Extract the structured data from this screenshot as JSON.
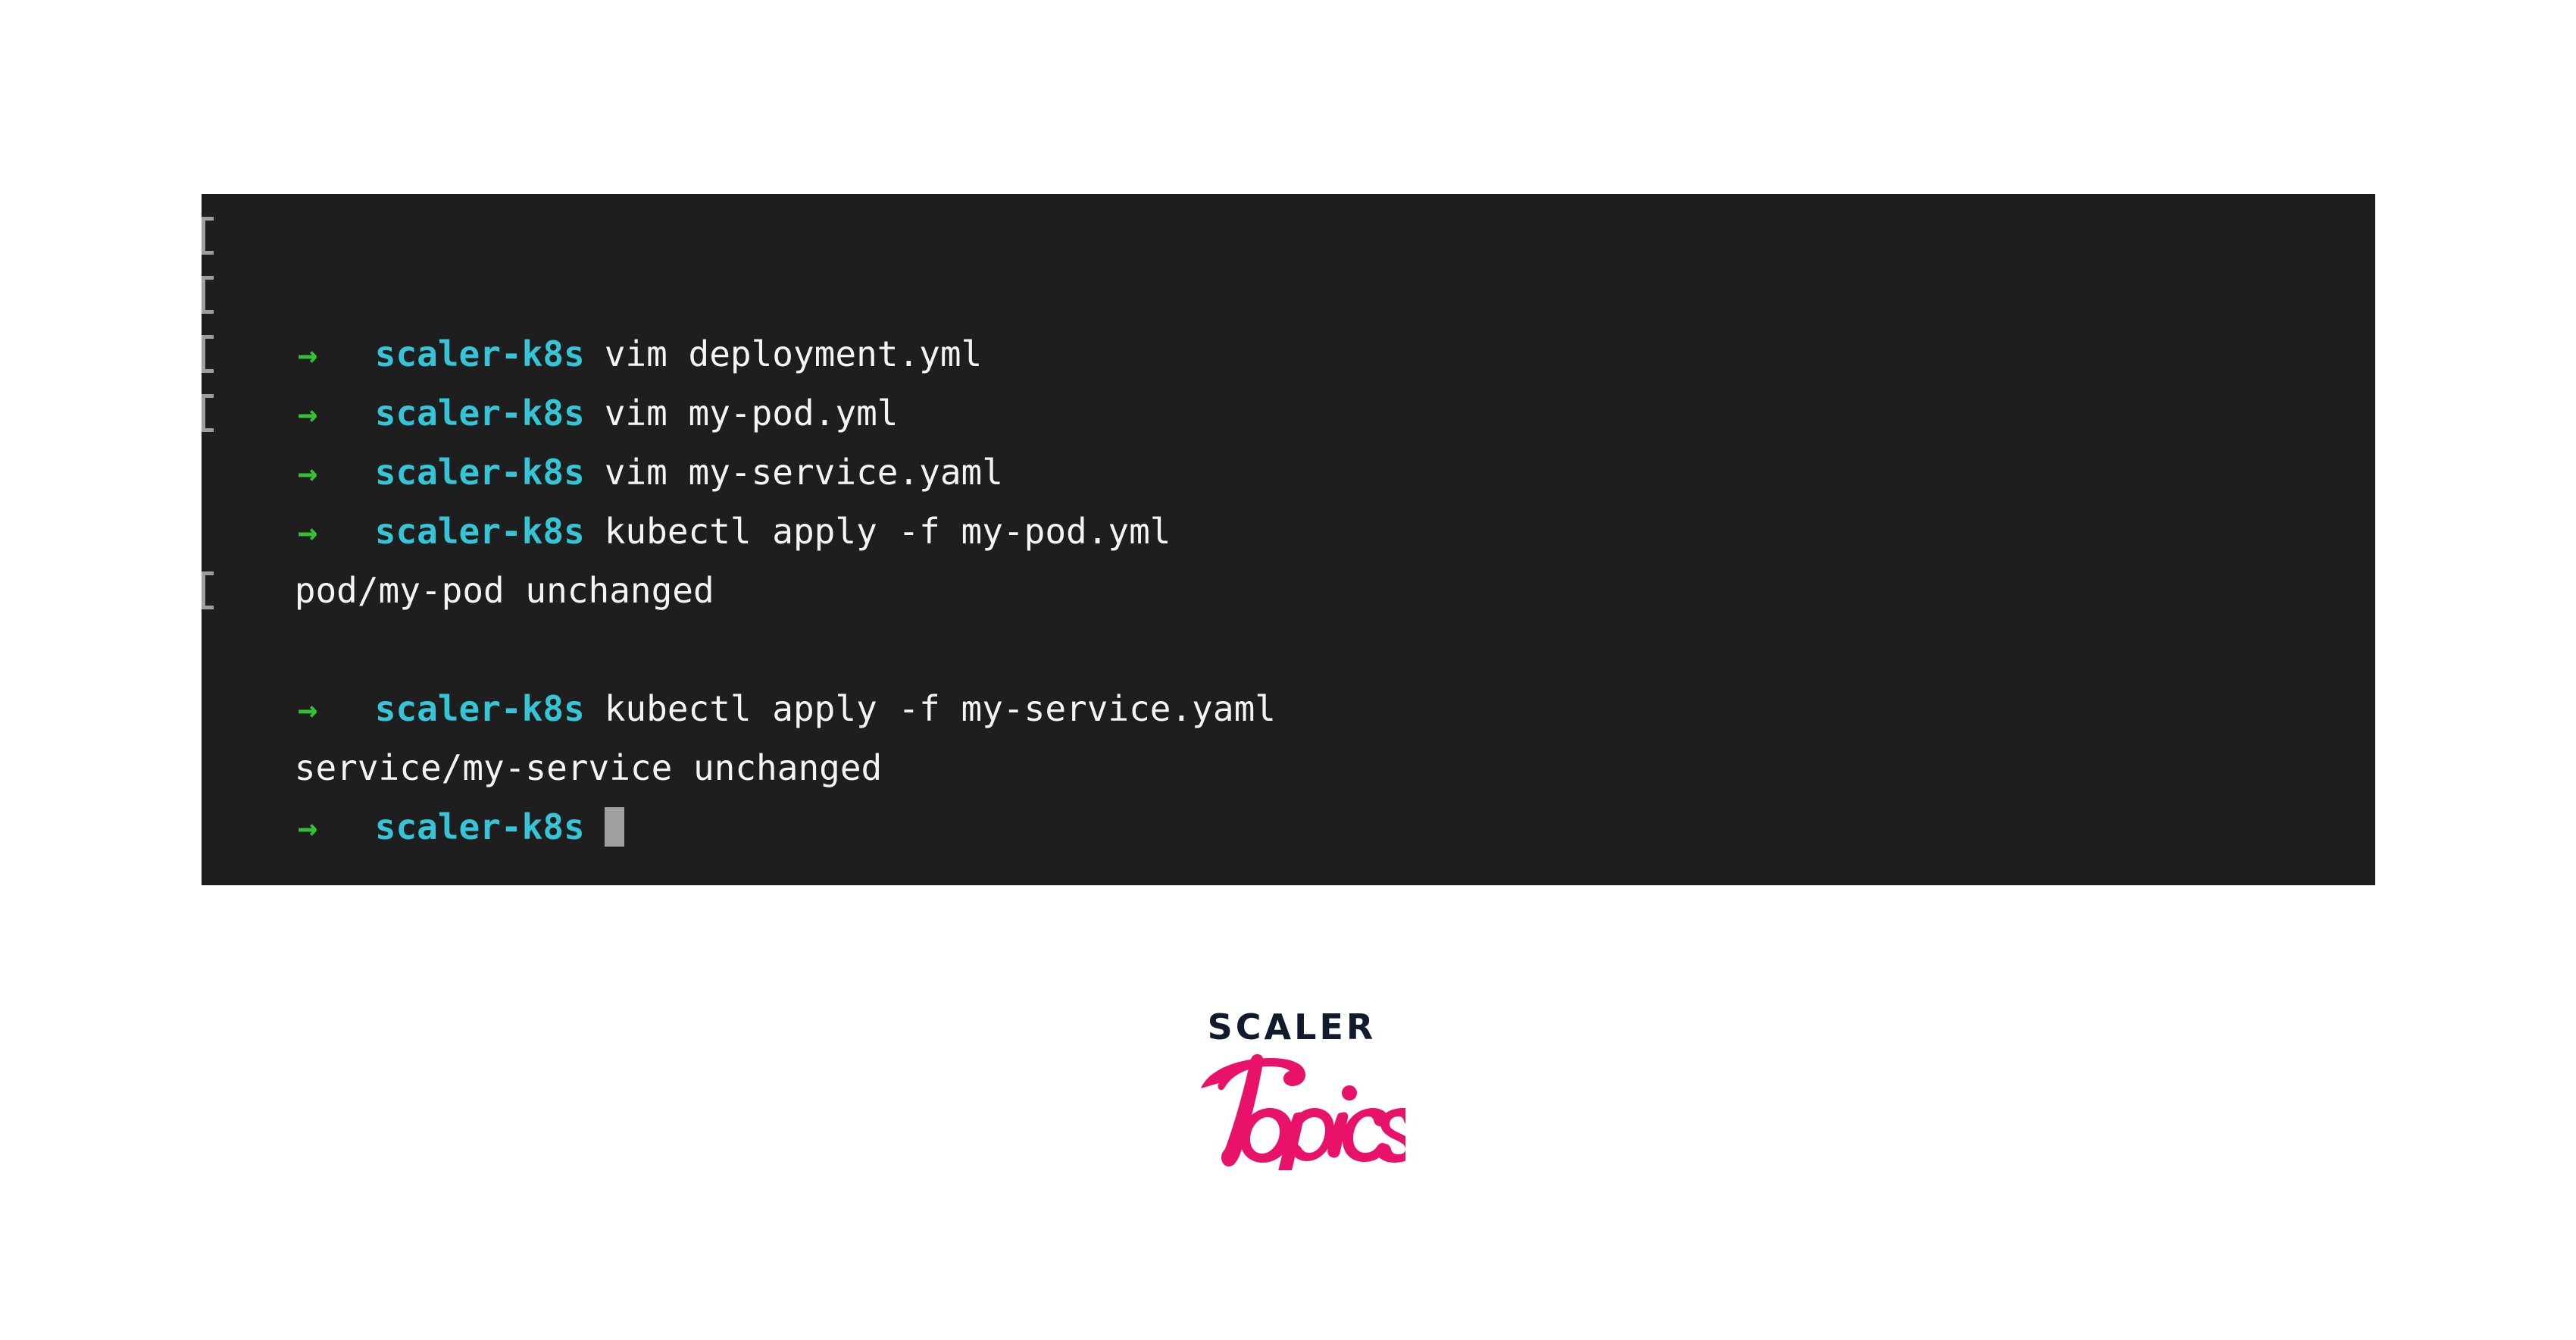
{
  "page": {
    "background_color": "#ffffff"
  },
  "terminal": {
    "background_color": "#1e1e1e",
    "prompt_symbol": "→",
    "prompt_symbol_color": "#35c135",
    "host_label": "scaler-k8s",
    "host_color": "#35c5d6",
    "text_color": "#f4f4f4",
    "cursor_color": "#9fa0a0",
    "prompt_mark_color": "#9e9e9e",
    "lines": [
      {
        "kind": "command",
        "host": "scaler-k8s",
        "command": "vim deployment.yml"
      },
      {
        "kind": "command",
        "host": "scaler-k8s",
        "command": "vim my-pod.yml"
      },
      {
        "kind": "command",
        "host": "scaler-k8s",
        "command": "vim my-service.yaml"
      },
      {
        "kind": "command",
        "host": "scaler-k8s",
        "command": "kubectl apply -f my-pod.yml"
      },
      {
        "kind": "blank",
        "text": ""
      },
      {
        "kind": "output",
        "text": "pod/my-pod unchanged"
      },
      {
        "kind": "command",
        "host": "scaler-k8s",
        "command": "kubectl apply -f my-service.yaml"
      },
      {
        "kind": "blank",
        "text": ""
      },
      {
        "kind": "output",
        "text": "service/my-service unchanged"
      },
      {
        "kind": "prompt",
        "host": "scaler-k8s",
        "command": ""
      }
    ]
  },
  "logo": {
    "wordmark": "SCALER",
    "wordmark_color": "#121b2e",
    "script": "Topics",
    "script_color": "#e8126b"
  }
}
